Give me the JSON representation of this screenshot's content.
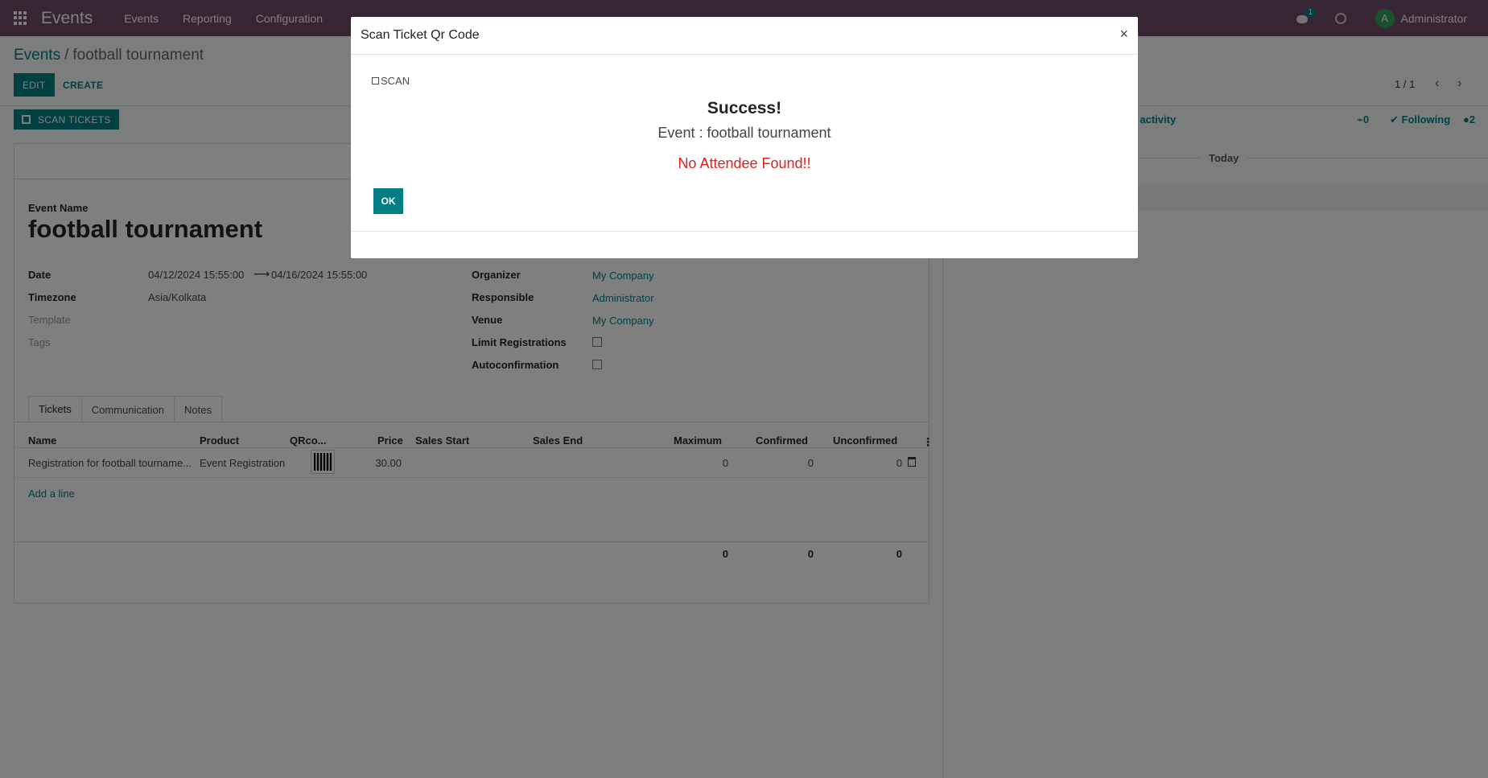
{
  "navbar": {
    "brand": "Events",
    "menu": [
      "Events",
      "Reporting",
      "Configuration"
    ],
    "chat_badge": "1",
    "avatar_initial": "A",
    "user_name": "Administrator"
  },
  "control_panel": {
    "breadcrumb_root": "Events",
    "breadcrumb_sep": "/",
    "breadcrumb_current": "football tournament",
    "edit_label": "EDIT",
    "create_label": "CREATE",
    "pager": "1 / 1",
    "scan_tickets_label": "SCAN TICKETS"
  },
  "form": {
    "event_name_label": "Event Name",
    "event_name": "football tournament",
    "date_label": "Date",
    "date_start": "04/12/2024 15:55:00",
    "date_end": "04/16/2024 15:55:00",
    "timezone_label": "Timezone",
    "timezone": "Asia/Kolkata",
    "template_label": "Template",
    "tags_label": "Tags",
    "organizer_label": "Organizer",
    "organizer": "My Company",
    "responsible_label": "Responsible",
    "responsible": "Administrator",
    "venue_label": "Venue",
    "venue": "My Company",
    "limit_label": "Limit Registrations",
    "autoconfirm_label": "Autoconfirmation"
  },
  "tabs": [
    "Tickets",
    "Communication",
    "Notes"
  ],
  "tickets_table": {
    "headers": [
      "Name",
      "Product",
      "QRco...",
      "Price",
      "Sales Start",
      "Sales End",
      "Maximum",
      "Confirmed",
      "Unconfirmed"
    ],
    "row": {
      "name": "Registration for football tourname...",
      "product": "Event Registration",
      "price": "30.00",
      "maximum": "0",
      "confirmed": "0",
      "unconfirmed": "0"
    },
    "add_line": "Add a line",
    "totals": [
      "0",
      "0",
      "0"
    ]
  },
  "chatter": {
    "schedule_activity": "ule activity",
    "attachments": "0",
    "following": "Following",
    "followers": "2",
    "today": "Today"
  },
  "modal": {
    "title": "Scan Ticket Qr Code",
    "close": "×",
    "scan_label": "SCAN",
    "success_title": "Success!",
    "event_line": "Event : football tournament",
    "status_message": "No Attendee Found!!",
    "ok_label": "OK",
    "status_color": "#e61a1a"
  },
  "colors": {
    "navbar": "#714b67",
    "primary": "#017e84"
  }
}
